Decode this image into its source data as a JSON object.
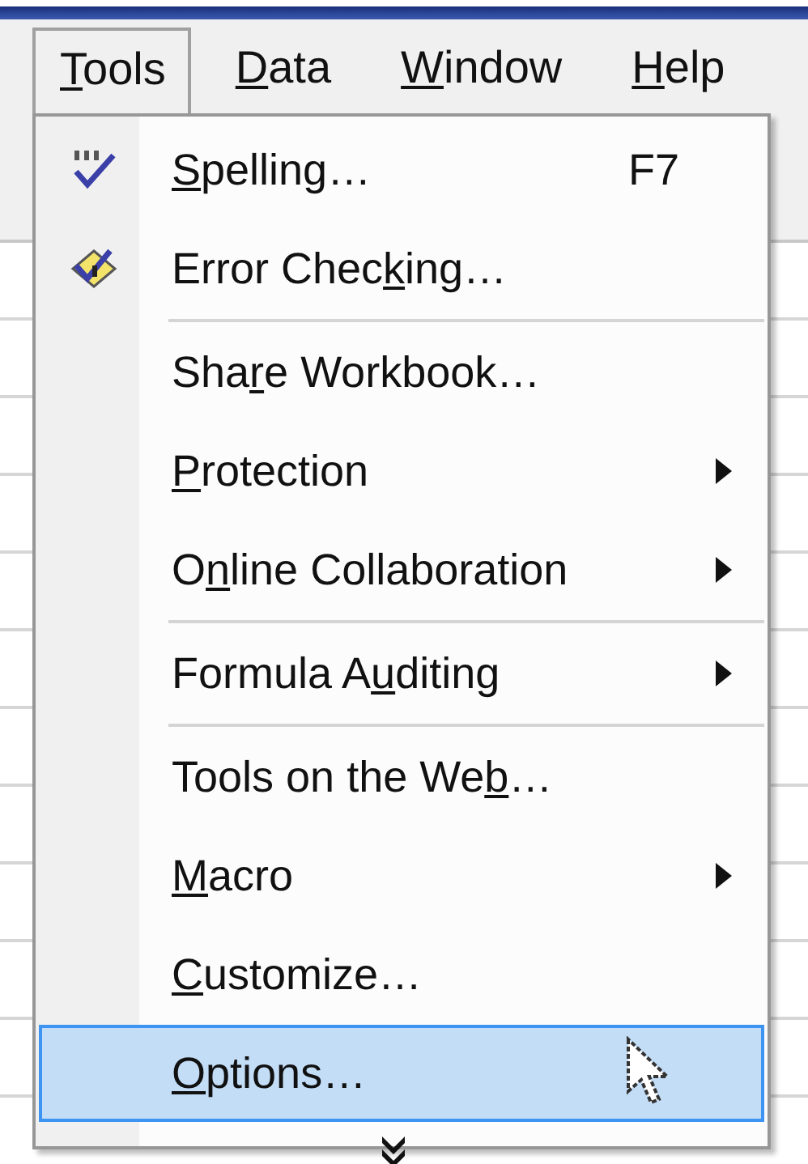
{
  "menubar": [
    {
      "key": "T",
      "post": "ools",
      "selected": true
    },
    {
      "key": "D",
      "post": "ata",
      "selected": false
    },
    {
      "key": "W",
      "post": "indow",
      "selected": false
    },
    {
      "key": "H",
      "post": "elp",
      "selected": false
    }
  ],
  "menu": {
    "items": [
      {
        "kind": "icon-item",
        "key": "S",
        "post": "pelling…",
        "shortcut": "F7",
        "submenu": false,
        "selected": false
      },
      {
        "kind": "icon-item",
        "pre": "Error Chec",
        "key": "k",
        "post": "ing…",
        "submenu": false,
        "selected": false
      },
      {
        "kind": "separator"
      },
      {
        "kind": "item",
        "pre": "Sha",
        "key": "r",
        "post": "e Workbook…",
        "submenu": false,
        "selected": false
      },
      {
        "kind": "item",
        "key": "P",
        "post": "rotection",
        "submenu": true,
        "selected": false
      },
      {
        "kind": "item",
        "pre": "O",
        "key": "n",
        "post": "line Collaboration",
        "submenu": true,
        "selected": false
      },
      {
        "kind": "separator"
      },
      {
        "kind": "item",
        "pre": "Formula A",
        "key": "u",
        "post": "diting",
        "submenu": true,
        "selected": false
      },
      {
        "kind": "separator"
      },
      {
        "kind": "item",
        "pre": "Tools on the We",
        "key": "b",
        "post": "…",
        "submenu": false,
        "selected": false
      },
      {
        "kind": "item",
        "key": "M",
        "post": "acro",
        "submenu": true,
        "selected": false
      },
      {
        "kind": "item",
        "key": "C",
        "post": "ustomize…",
        "submenu": false,
        "selected": false
      },
      {
        "kind": "item",
        "key": "O",
        "post": "ptions…",
        "submenu": false,
        "selected": true
      },
      {
        "kind": "expand"
      }
    ]
  }
}
